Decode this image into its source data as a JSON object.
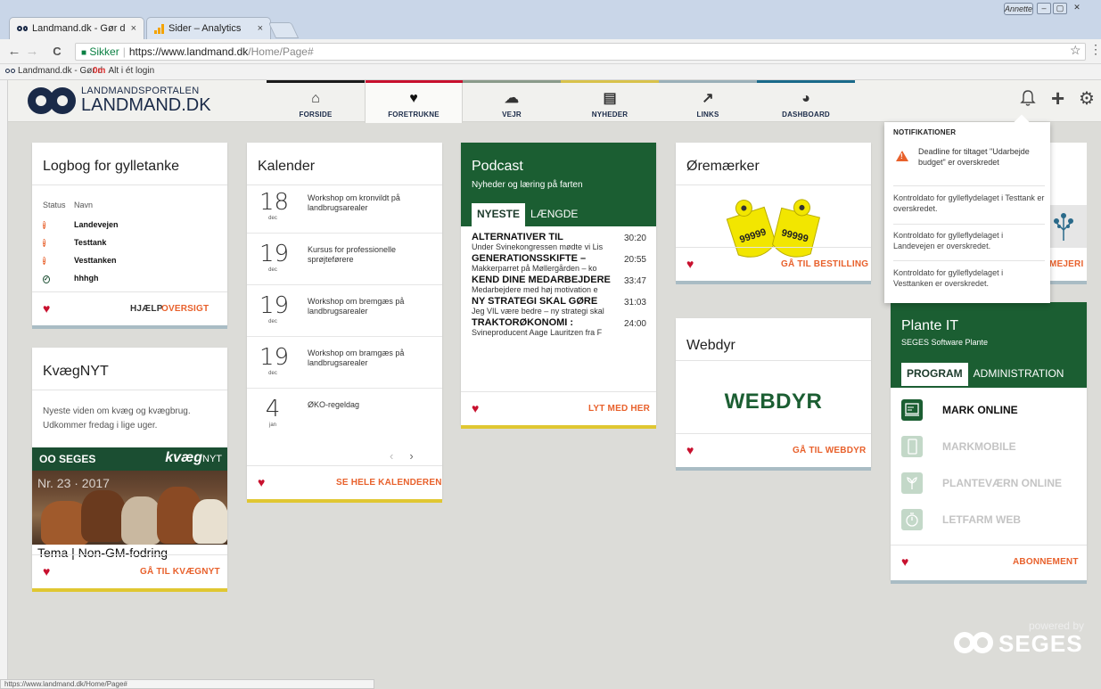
{
  "browser": {
    "tabs": [
      {
        "title": "Landmand.dk - Gør det l",
        "close": "×"
      },
      {
        "title": "Sider – Analytics",
        "close": "×"
      }
    ],
    "user_button": "Annette",
    "window_buttons": [
      "–",
      "▢",
      "✕"
    ],
    "nav": {
      "back": "←",
      "forward": "→",
      "reload": "C"
    },
    "address": {
      "secure_label": "Sikker",
      "host": "https://www.landmand.dk",
      "path": "/Home/Page#"
    },
    "bookmarks": [
      {
        "label": "Landmand.dk - Gør d"
      },
      {
        "label": "Alt i ét login",
        "icon_text": "0m"
      }
    ],
    "status_url": "https://www.landmand.dk/Home/Page#"
  },
  "header": {
    "logo_line1": "LANDMANDSPORTALEN",
    "logo_line2": "LANDMAND.DK",
    "nav": [
      {
        "label": "FORSIDE",
        "icon": "home-icon",
        "glyph": "⌂",
        "color": "#1a1a1a"
      },
      {
        "label": "FORETRUKNE",
        "icon": "heart-icon",
        "glyph": "♥",
        "color": "#c8102e"
      },
      {
        "label": "VEJR",
        "icon": "cloud-icon",
        "glyph": "☁",
        "color": "#8a9a8a"
      },
      {
        "label": "NYHEDER",
        "icon": "newspaper-icon",
        "glyph": "▤",
        "color": "#d8c24a"
      },
      {
        "label": "LINKS",
        "icon": "external-link-icon",
        "glyph": "↗",
        "color": "#9ab0b8"
      },
      {
        "label": "DASHBOARD",
        "icon": "dashboard-icon",
        "glyph": "◕",
        "color": "#1a6a8a"
      }
    ],
    "icons": {
      "bell": "🔔",
      "plus": "+",
      "gear": "⚙"
    }
  },
  "logbog": {
    "title": "Logbog for gylletanke",
    "col_status": "Status",
    "col_name": "Navn",
    "rows": [
      {
        "name": "Landevejen",
        "status": "warning",
        "mark": "!"
      },
      {
        "name": "Testtank",
        "status": "warning",
        "mark": "!"
      },
      {
        "name": "Vesttanken",
        "status": "warning",
        "mark": "!"
      },
      {
        "name": "hhhgh",
        "status": "ok",
        "mark": "✓"
      }
    ],
    "help": "HJÆLP",
    "overview": "OVERSIGT"
  },
  "kvaegnyt": {
    "title": "KvægNYT",
    "description": "Nyeste viden om kvæg og kvægbrug. Udkommer fredag i lige uger.",
    "banner_brand": "SEGES",
    "banner_kv": "kvæg",
    "banner_nyt": "NYT",
    "issue": "Nr. 23 · 2017",
    "tema": "Tema | Non-GM-fodring",
    "link": "GÅ TIL KVÆGNYT"
  },
  "kalender": {
    "title": "Kalender",
    "events": [
      {
        "day": "18",
        "month": "dec",
        "title": "Workshop om kronvildt på landbrugsarealer"
      },
      {
        "day": "19",
        "month": "dec",
        "title": "Kursus for professionelle sprøjteførere"
      },
      {
        "day": "19",
        "month": "dec",
        "title": "Workshop om bremgæs på landbrugsarealer"
      },
      {
        "day": "19",
        "month": "dec",
        "title": "Workshop om bramgæs på landbrugsarealer"
      },
      {
        "day": "4",
        "month": "jan",
        "title": "ØKO-regeldag"
      }
    ],
    "prev": "‹",
    "next": "›",
    "link": "SE HELE KALENDEREN"
  },
  "podcast": {
    "title": "Podcast",
    "subtitle": "Nyheder og læring på farten",
    "tabs": [
      "NYESTE",
      "LÆNGDE"
    ],
    "items": [
      {
        "title": "ALTERNATIVER TIL",
        "desc": "Under Svinekongressen mødte vi Lis",
        "length": "30:20"
      },
      {
        "title": "GENERATIONSSKIFTE –",
        "desc": "Makkerparret på Møllergården – ko",
        "length": "20:55"
      },
      {
        "title": "KEND DINE MEDARBEJDERE",
        "desc": "Medarbejdere med høj motivation e",
        "length": "33:47"
      },
      {
        "title": "NY STRATEGI SKAL GØRE",
        "desc": "Jeg VIL være bedre – ny strategi skal",
        "length": "31:03"
      },
      {
        "title": "TRAKTORØKONOMI :",
        "desc": "Svineproducent Aage Lauritzen fra F",
        "length": "24:00"
      }
    ],
    "link": "LYT MED HER"
  },
  "oremaerker": {
    "title": "Øremærker",
    "tag_text": "99999",
    "link": "GÅ TIL BESTILLING"
  },
  "webdyr": {
    "title": "Webdyr",
    "logo": "WEBDYR",
    "link": "GÅ TIL WEBDYR"
  },
  "peek": {
    "link": "MEJERI"
  },
  "plante": {
    "title": "Plante IT",
    "subtitle": "SEGES Software Plante",
    "tabs": [
      "PROGRAM",
      "ADMINISTRATION"
    ],
    "programs": [
      {
        "label": "MARK ONLINE",
        "active": true
      },
      {
        "label": "MARKMOBILE",
        "active": false
      },
      {
        "label": "PLANTEVÆRN ONLINE",
        "active": false
      },
      {
        "label": "LETFARM WEB",
        "active": false
      }
    ],
    "link": "ABONNEMENT"
  },
  "notifications": {
    "title": "NOTIFIKATIONER",
    "warning": "Deadline for tiltaget \"Udarbejde budget\" er overskredet",
    "items": [
      "Kontroldato for gylleflydelaget i Testtank er overskredet.",
      "Kontroldato for gylleflydelaget i Landevejen er overskredet.",
      "Kontroldato for gylleflydelaget i Vesttanken er overskredet."
    ]
  },
  "powered": {
    "by": "powered by",
    "name": "SEGES"
  },
  "colors": {
    "green": "#1b5e32",
    "orange": "#e8612c",
    "heart": "#c8102e",
    "navy": "#1a2a48",
    "bar_yellow": "#e0c732",
    "bar_blue": "#a9bcc4"
  }
}
